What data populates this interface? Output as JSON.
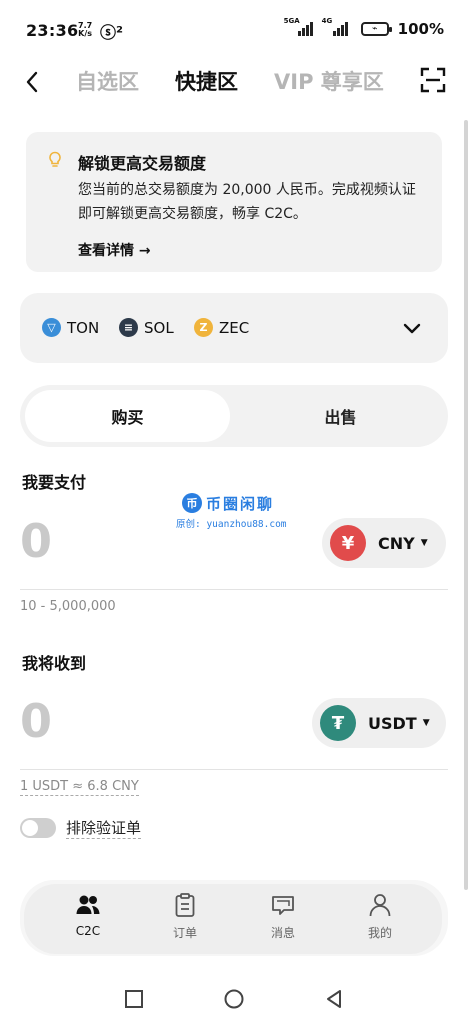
{
  "status_bar": {
    "time": "23:36",
    "speed_value": "7.7",
    "speed_unit": "K/s",
    "extra": "ⓢ²",
    "signal1_label": "5GA",
    "signal2_label": "4G",
    "battery_label": "⌁",
    "battery_percent": "100%"
  },
  "nav": {
    "back_icon": "chevron-left-icon",
    "tabs": [
      {
        "label": "自选区",
        "active": false
      },
      {
        "label": "快捷区",
        "active": true
      },
      {
        "label": "VIP 尊享区",
        "active": false
      }
    ],
    "scan_icon": "scan-icon"
  },
  "promo": {
    "icon": "lightbulb-icon",
    "title": "解锁更高交易额度",
    "text": "您当前的总交易额度为 20,000 人民币。完成视频认证即可解锁更高交易额度，畅享 C2C。",
    "link": "查看详情 →"
  },
  "coins": [
    {
      "code": "TON",
      "color": "#3a8ed8"
    },
    {
      "code": "SOL",
      "color": "#2d3a4a"
    },
    {
      "code": "ZEC",
      "color": "#f0b43c"
    }
  ],
  "trade_mode": {
    "buy_label": "购买",
    "sell_label": "出售",
    "active": "buy"
  },
  "pay": {
    "label": "我要支付",
    "amount": "0",
    "currency_code": "CNY",
    "currency_symbol": "¥",
    "currency_color": "#e14b4b",
    "range": "10 - 5,000,000"
  },
  "receive": {
    "label": "我将收到",
    "amount": "0",
    "currency_code": "USDT",
    "currency_symbol": "₮",
    "currency_color": "#2f8a7c",
    "rate": "1 USDT ≈ 6.8 CNY"
  },
  "exclude_verify": {
    "label": "排除验证单",
    "enabled": false
  },
  "watermark": {
    "logo_char": "币",
    "title": "币圈闲聊",
    "subtitle": "原创: yuanzhou88.com"
  },
  "bottom_tabs": [
    {
      "label": "C2C",
      "icon": "users-icon",
      "active": true
    },
    {
      "label": "订单",
      "icon": "clipboard-icon",
      "active": false
    },
    {
      "label": "消息",
      "icon": "chat-icon",
      "active": false
    },
    {
      "label": "我的",
      "icon": "person-icon",
      "active": false
    }
  ]
}
